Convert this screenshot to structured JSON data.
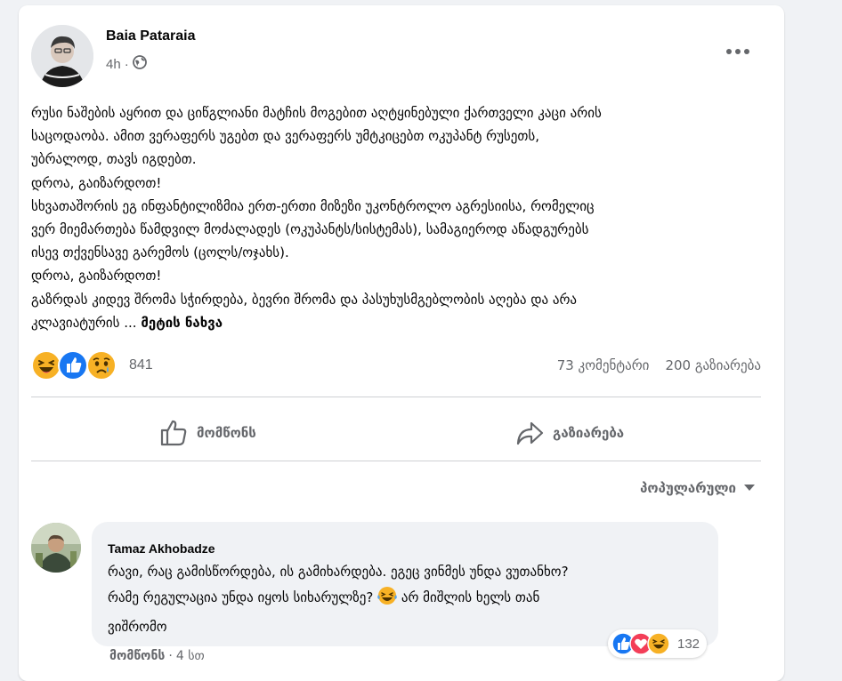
{
  "post": {
    "author": "Baia Pataraia",
    "time": "4h",
    "dot": "·",
    "audience_icon": "globe-icon",
    "more_icon": "more-horizontal-icon",
    "body_lines": [
      "რუსი ნაშების აყრით და ციწგლიანი მატჩის მოგებით აღტყინებული ქართველი კაცი არის",
      "საცოდაობა. ამით ვერაფერს უგებთ და ვერაფერს უმტკიცებთ ოკუპანტ რუსეთს,",
      "უბრალოდ, თავს იგდებთ.",
      "დროა, გაიზარდოთ!",
      "სხვათაშორის ეგ ინფანტილიზმია ერთ-ერთი მიზეზი უკონტროლო აგრესიისა, რომელიც",
      "ვერ მიემართება წამდვილ მოძალადეს (ოკუპანტს/სისტემას), სამაგიეროდ აწადგურებს",
      "ისევ თქვენსავე გარემოს (ცოლს/ოჯახს).",
      "დროა, გაიზარდოთ!",
      "გაზრდას კიდევ შრომა სჭირდება, ბევრი შრომა და პასუხუსმგებლობის აღება და არა"
    ],
    "last_line_text": "კლავიატურის ... ",
    "see_more": "მეტის ნახვა",
    "reactions": {
      "icons": [
        "haha-icon",
        "like-icon",
        "sad-icon"
      ],
      "count": "841"
    },
    "comments_count": "73 კომენტარი",
    "shares_count": "200 გაზიარება",
    "like_button": "მომწონს",
    "share_button": "გაზიარება"
  },
  "sort": {
    "label": "პოპულარული",
    "icon": "caret-down-icon"
  },
  "comment": {
    "author": "Tamaz Akhobadze",
    "line1": "რავი, რაც გამისწორდება, ის გამიხარდება. ეგეც ვინმეს უნდა ვუთანხო?",
    "line2_before": "რამე რეგულაცია უნდა იყოს სიხარულზე? ",
    "line2_emoji": "laughing-tears-emoji",
    "line2_after": " არ მიშლის ხელს თან",
    "line3": "ვიშრომო",
    "reaction_icons": [
      "like-icon",
      "love-icon",
      "haha-icon"
    ],
    "reaction_count": "132",
    "like_action": "მომწონს",
    "dot": "·",
    "time": "4 სთ"
  },
  "colors": {
    "like_blue": "#1877f2",
    "love_red": "#f33e58",
    "haha_yellow": "#f7b125",
    "secondary_text": "#65676b"
  }
}
